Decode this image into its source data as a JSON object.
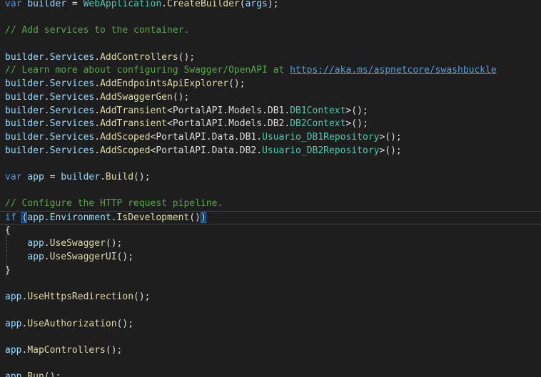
{
  "colors": {
    "background": "#1e1e1e",
    "keyword": "#569cd6",
    "identifier": "#9cdcfe",
    "type": "#4ec9b0",
    "method": "#dcdcaa",
    "comment": "#57a64a",
    "plain": "#dcdcdc"
  },
  "editor": {
    "current_line": 16,
    "lines": [
      [
        {
          "t": "var",
          "c": "kw"
        },
        {
          "t": " ",
          "c": "plain"
        },
        {
          "t": "builder",
          "c": "var"
        },
        {
          "t": " = ",
          "c": "plain"
        },
        {
          "t": "WebApplication",
          "c": "type"
        },
        {
          "t": ".",
          "c": "plain"
        },
        {
          "t": "CreateBuilder",
          "c": "method"
        },
        {
          "t": "(",
          "c": "plain"
        },
        {
          "t": "args",
          "c": "var"
        },
        {
          "t": ");",
          "c": "plain"
        }
      ],
      [],
      [
        {
          "t": "// Add services to the container.",
          "c": "comment"
        }
      ],
      [],
      [
        {
          "t": "builder",
          "c": "var"
        },
        {
          "t": ".",
          "c": "plain"
        },
        {
          "t": "Services",
          "c": "var"
        },
        {
          "t": ".",
          "c": "plain"
        },
        {
          "t": "AddControllers",
          "c": "method"
        },
        {
          "t": "();",
          "c": "plain"
        }
      ],
      [
        {
          "t": "// Learn more about configuring Swagger/OpenAPI at ",
          "c": "comment"
        },
        {
          "t": "https://aka.ms/aspnetcore/swashbuckle",
          "c": "link"
        }
      ],
      [
        {
          "t": "builder",
          "c": "var"
        },
        {
          "t": ".",
          "c": "plain"
        },
        {
          "t": "Services",
          "c": "var"
        },
        {
          "t": ".",
          "c": "plain"
        },
        {
          "t": "AddEndpointsApiExplorer",
          "c": "method"
        },
        {
          "t": "();",
          "c": "plain"
        }
      ],
      [
        {
          "t": "builder",
          "c": "var"
        },
        {
          "t": ".",
          "c": "plain"
        },
        {
          "t": "Services",
          "c": "var"
        },
        {
          "t": ".",
          "c": "plain"
        },
        {
          "t": "AddSwaggerGen",
          "c": "method"
        },
        {
          "t": "();",
          "c": "plain"
        }
      ],
      [
        {
          "t": "builder",
          "c": "var"
        },
        {
          "t": ".",
          "c": "plain"
        },
        {
          "t": "Services",
          "c": "var"
        },
        {
          "t": ".",
          "c": "plain"
        },
        {
          "t": "AddTransient",
          "c": "method"
        },
        {
          "t": "<PortalAPI.Models.DB1.",
          "c": "plain"
        },
        {
          "t": "DB1Context",
          "c": "type"
        },
        {
          "t": ">();",
          "c": "plain"
        }
      ],
      [
        {
          "t": "builder",
          "c": "var"
        },
        {
          "t": ".",
          "c": "plain"
        },
        {
          "t": "Services",
          "c": "var"
        },
        {
          "t": ".",
          "c": "plain"
        },
        {
          "t": "AddTransient",
          "c": "method"
        },
        {
          "t": "<PortalAPI.Models.DB2.",
          "c": "plain"
        },
        {
          "t": "DB2Context",
          "c": "type"
        },
        {
          "t": ">();",
          "c": "plain"
        }
      ],
      [
        {
          "t": "builder",
          "c": "var"
        },
        {
          "t": ".",
          "c": "plain"
        },
        {
          "t": "Services",
          "c": "var"
        },
        {
          "t": ".",
          "c": "plain"
        },
        {
          "t": "AddScoped",
          "c": "method"
        },
        {
          "t": "<PortalAPI.Data.DB1.",
          "c": "plain"
        },
        {
          "t": "Usuario_DB1Repository",
          "c": "type"
        },
        {
          "t": ">();",
          "c": "plain"
        }
      ],
      [
        {
          "t": "builder",
          "c": "var"
        },
        {
          "t": ".",
          "c": "plain"
        },
        {
          "t": "Services",
          "c": "var"
        },
        {
          "t": ".",
          "c": "plain"
        },
        {
          "t": "AddScoped",
          "c": "method"
        },
        {
          "t": "<PortalAPI.Data.DB2.",
          "c": "plain"
        },
        {
          "t": "Usuario_DB2Repository",
          "c": "type"
        },
        {
          "t": ">();",
          "c": "plain"
        }
      ],
      [],
      [
        {
          "t": "var",
          "c": "kw"
        },
        {
          "t": " ",
          "c": "plain"
        },
        {
          "t": "app",
          "c": "var"
        },
        {
          "t": " = ",
          "c": "plain"
        },
        {
          "t": "builder",
          "c": "var"
        },
        {
          "t": ".",
          "c": "plain"
        },
        {
          "t": "Build",
          "c": "method"
        },
        {
          "t": "();",
          "c": "plain"
        }
      ],
      [],
      [
        {
          "t": "// Configure the HTTP request pipeline.",
          "c": "comment"
        }
      ],
      [
        {
          "t": "if",
          "c": "kw"
        },
        {
          "t": " ",
          "c": "plain"
        },
        {
          "t": "(",
          "c": "paren-match"
        },
        {
          "t": "app",
          "c": "var"
        },
        {
          "t": ".",
          "c": "plain"
        },
        {
          "t": "Environment",
          "c": "var"
        },
        {
          "t": ".",
          "c": "plain"
        },
        {
          "t": "IsDevelopment",
          "c": "method"
        },
        {
          "t": "()",
          "c": "plain"
        },
        {
          "t": ")",
          "c": "paren-match"
        }
      ],
      [
        {
          "t": "{",
          "c": "plain"
        }
      ],
      [
        {
          "t": "    ",
          "c": "plain"
        },
        {
          "t": "app",
          "c": "var"
        },
        {
          "t": ".",
          "c": "plain"
        },
        {
          "t": "UseSwagger",
          "c": "method"
        },
        {
          "t": "();",
          "c": "plain"
        }
      ],
      [
        {
          "t": "    ",
          "c": "plain"
        },
        {
          "t": "app",
          "c": "var"
        },
        {
          "t": ".",
          "c": "plain"
        },
        {
          "t": "UseSwaggerUI",
          "c": "method"
        },
        {
          "t": "();",
          "c": "plain"
        }
      ],
      [
        {
          "t": "}",
          "c": "plain"
        }
      ],
      [],
      [
        {
          "t": "app",
          "c": "var"
        },
        {
          "t": ".",
          "c": "plain"
        },
        {
          "t": "UseHttpsRedirection",
          "c": "method"
        },
        {
          "t": "();",
          "c": "plain"
        }
      ],
      [],
      [
        {
          "t": "app",
          "c": "var"
        },
        {
          "t": ".",
          "c": "plain"
        },
        {
          "t": "UseAuthorization",
          "c": "method"
        },
        {
          "t": "();",
          "c": "plain"
        }
      ],
      [],
      [
        {
          "t": "app",
          "c": "var"
        },
        {
          "t": ".",
          "c": "plain"
        },
        {
          "t": "MapControllers",
          "c": "method"
        },
        {
          "t": "();",
          "c": "plain"
        }
      ],
      [],
      [
        {
          "t": "app",
          "c": "var"
        },
        {
          "t": ".",
          "c": "plain"
        },
        {
          "t": "Run",
          "c": "method"
        },
        {
          "t": "();",
          "c": "plain"
        }
      ]
    ]
  }
}
